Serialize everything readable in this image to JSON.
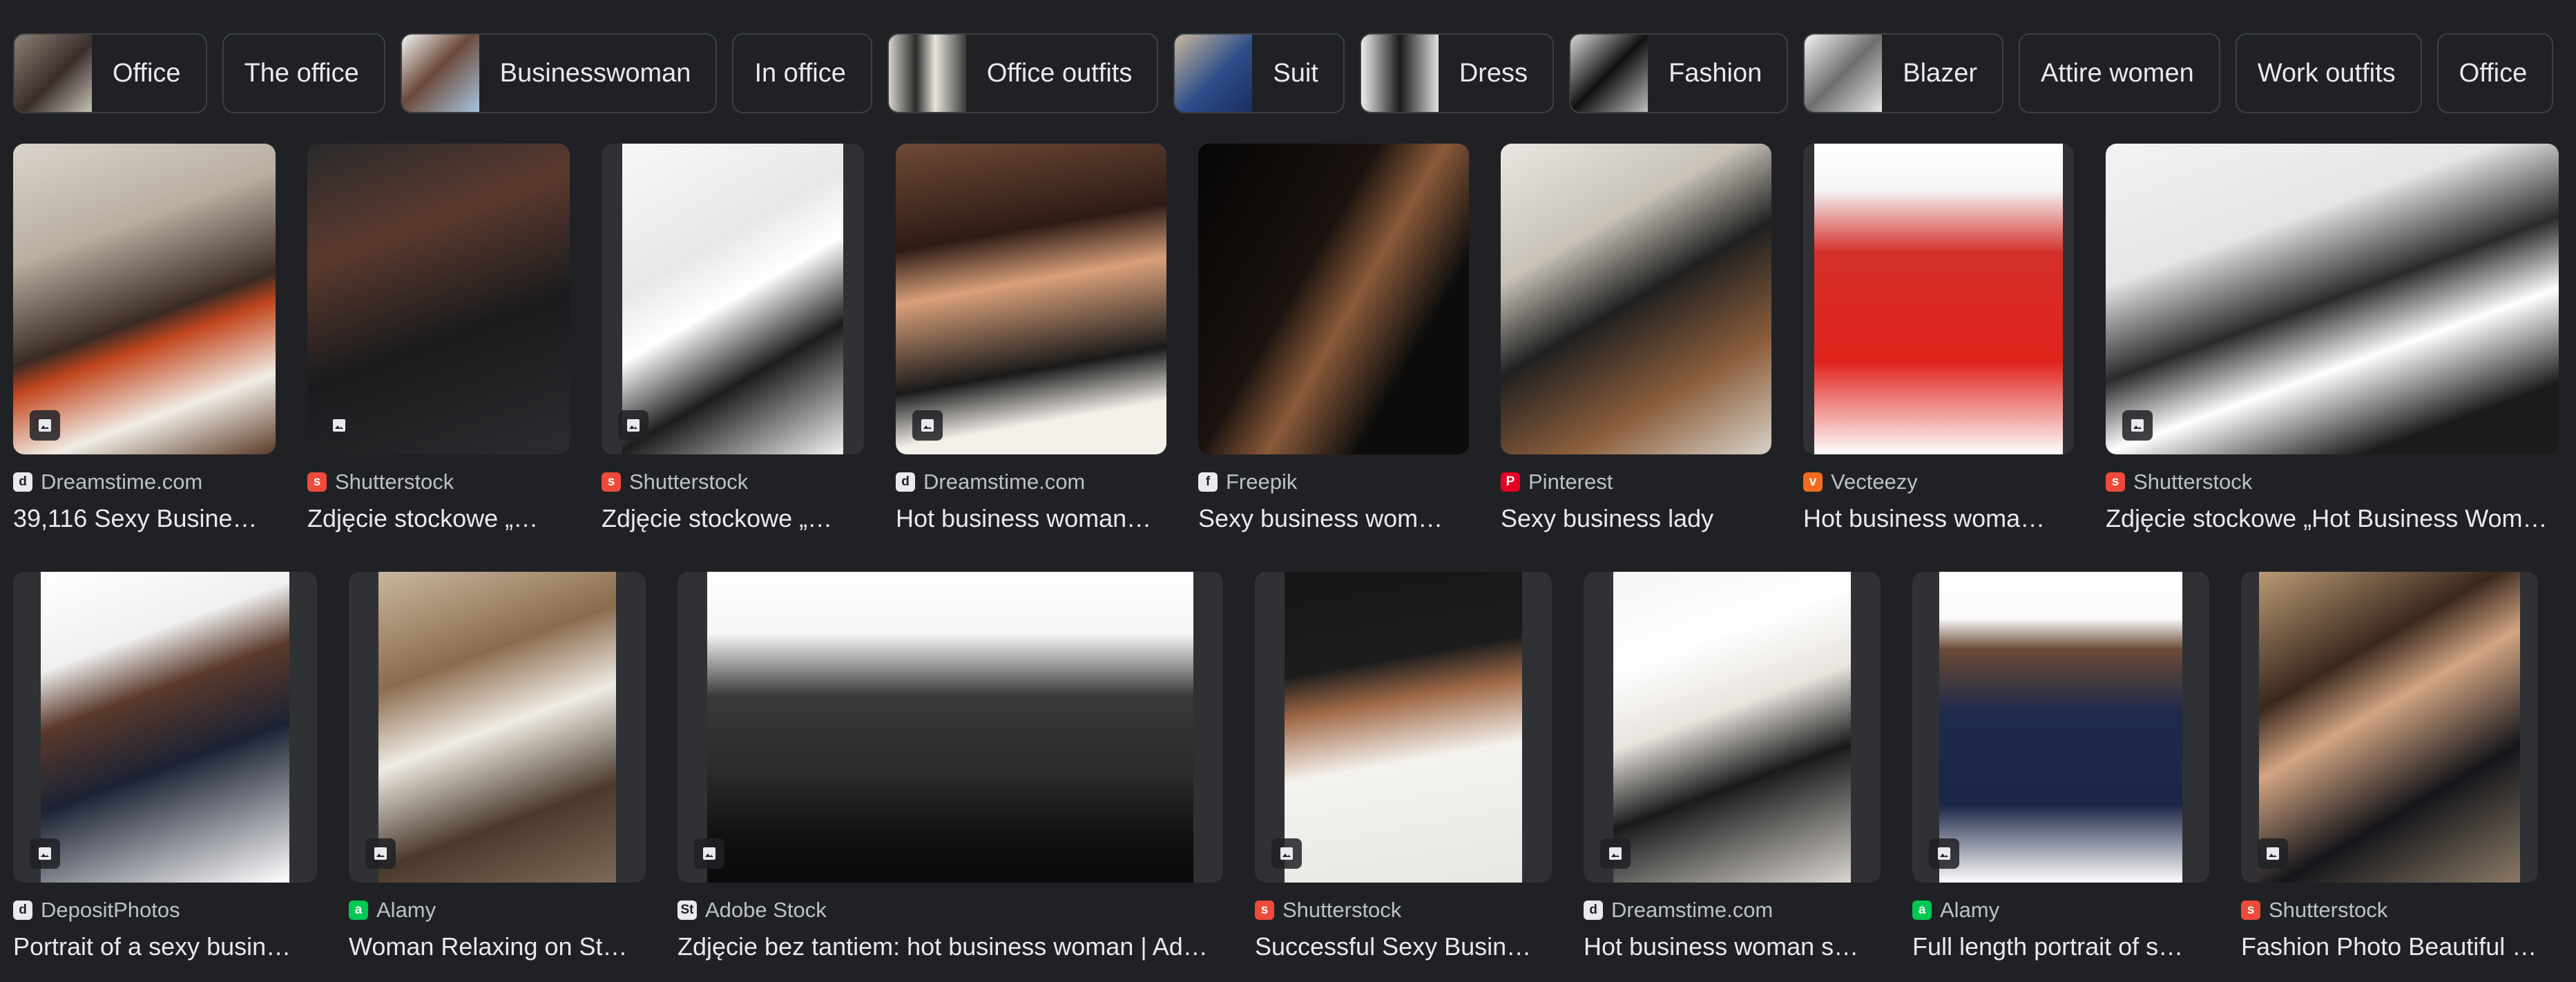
{
  "chips": [
    {
      "label": "Office"
    },
    {
      "label": "The office"
    },
    {
      "label": "Businesswoman"
    },
    {
      "label": "In office"
    },
    {
      "label": "Office outfits"
    },
    {
      "label": "Suit"
    },
    {
      "label": "Dress"
    },
    {
      "label": "Fashion"
    },
    {
      "label": "Blazer"
    },
    {
      "label": "Attire women"
    },
    {
      "label": "Work outfits"
    },
    {
      "label": "Office"
    }
  ],
  "results_row1": [
    {
      "source": "Dreamstime.com",
      "title": "39,116 Sexy Busine…"
    },
    {
      "source": "Shutterstock",
      "title": "Zdjęcie stockowe „…"
    },
    {
      "source": "Shutterstock",
      "title": "Zdjęcie stockowe „…"
    },
    {
      "source": "Dreamstime.com",
      "title": "Hot business woman…"
    },
    {
      "source": "Freepik",
      "title": "Sexy business wom…"
    },
    {
      "source": "Pinterest",
      "title": "Sexy business lady"
    },
    {
      "source": "Vecteezy",
      "title": "Hot business woma…"
    },
    {
      "source": "Shutterstock",
      "title": "Zdjęcie stockowe „Hot Business Wom…"
    }
  ],
  "results_row2": [
    {
      "source": "DepositPhotos",
      "title": "Portrait of a sexy busin…"
    },
    {
      "source": "Alamy",
      "title": "Woman Relaxing on St…"
    },
    {
      "source": "Adobe Stock",
      "title": "Zdjęcie bez tantiem: hot business woman | Ad…"
    },
    {
      "source": "Shutterstock",
      "title": "Successful Sexy Busin…"
    },
    {
      "source": "Dreamstime.com",
      "title": "Hot business woman s…"
    },
    {
      "source": "Alamy",
      "title": "Full length portrait of s…"
    },
    {
      "source": "Shutterstock",
      "title": "Fashion Photo Beautiful …"
    }
  ],
  "colors": {
    "background": "#202124",
    "chip_border": "#3c4043",
    "text_primary": "#e8eaed",
    "text_secondary": "#bdc1c6",
    "shutterstock": "#ee4a3a",
    "pinterest": "#e60023",
    "alamy": "#00c853",
    "vecteezy": "#f26b1d"
  },
  "icons": {
    "image_badge": "image-icon",
    "favicons": {
      "Dreamstime.com": "dreamstime-icon",
      "Shutterstock": "shutterstock-icon",
      "Freepik": "freepik-icon",
      "Pinterest": "pinterest-icon",
      "Vecteezy": "vecteezy-icon",
      "DepositPhotos": "depositphotos-icon",
      "Alamy": "alamy-icon",
      "Adobe Stock": "adobe-stock-icon"
    }
  }
}
